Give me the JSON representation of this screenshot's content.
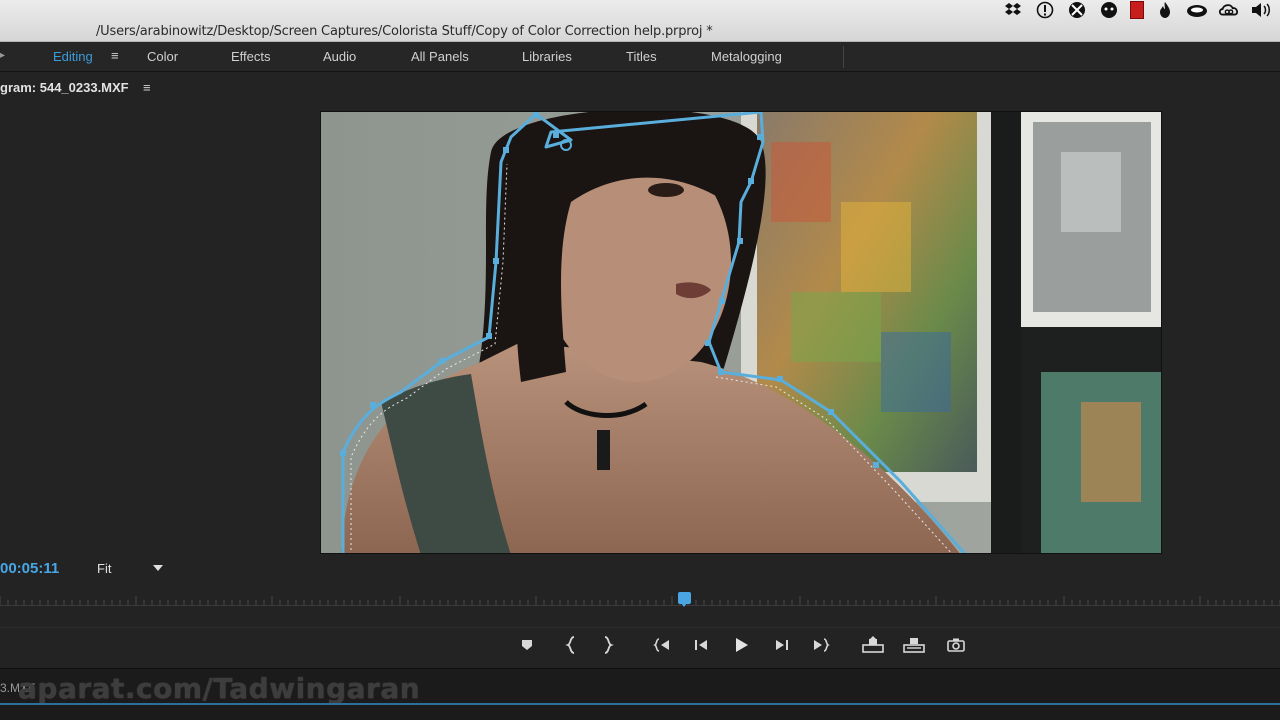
{
  "window": {
    "title": "/Users/arabinowitz/Desktop/Screen Captures/Colorista Stuff/Copy of Color Correction help.prproj *"
  },
  "menubar_tray": {
    "icons": [
      "dropbox-icon",
      "alert-icon",
      "crossover-icon",
      "game-icon",
      "red-app-icon",
      "flame-icon",
      "cloud-icon",
      "creative-cloud-icon",
      "volume-icon"
    ]
  },
  "workspaces": {
    "tabs": [
      {
        "label": "Editing",
        "active": true
      },
      {
        "label": "Color"
      },
      {
        "label": "Effects"
      },
      {
        "label": "Audio"
      },
      {
        "label": "All Panels"
      },
      {
        "label": "Libraries"
      },
      {
        "label": "Titles"
      },
      {
        "label": "Metalogging"
      }
    ],
    "menu_glyph": "≡",
    "active_color": "#3c9bd9"
  },
  "program_monitor": {
    "header": "gram: 544_0233.MXF",
    "menu_glyph": "≡",
    "timecode": "00:05:11",
    "fit_value": "Fit",
    "accent_color": "#4aa6e2",
    "playhead_position": 0.535
  },
  "transport": {
    "buttons": [
      {
        "name": "add-marker-button",
        "icon": "marker-icon"
      },
      {
        "name": "mark-in-button",
        "icon": "mark-in-icon"
      },
      {
        "name": "mark-out-button",
        "icon": "mark-out-icon"
      },
      {
        "name": "go-to-in-button",
        "icon": "go-to-in-icon"
      },
      {
        "name": "step-back-button",
        "icon": "step-back-icon"
      },
      {
        "name": "play-button",
        "icon": "play-icon"
      },
      {
        "name": "step-forward-button",
        "icon": "step-forward-icon"
      },
      {
        "name": "go-to-out-button",
        "icon": "go-to-out-icon"
      },
      {
        "name": "lift-button",
        "icon": "lift-icon"
      },
      {
        "name": "extract-button",
        "icon": "extract-icon"
      },
      {
        "name": "export-frame-button",
        "icon": "camera-icon"
      }
    ]
  },
  "bottom_panel": {
    "file_label": "3.MXF"
  },
  "watermark": {
    "text": "aparat.com/Tadwingaran"
  }
}
